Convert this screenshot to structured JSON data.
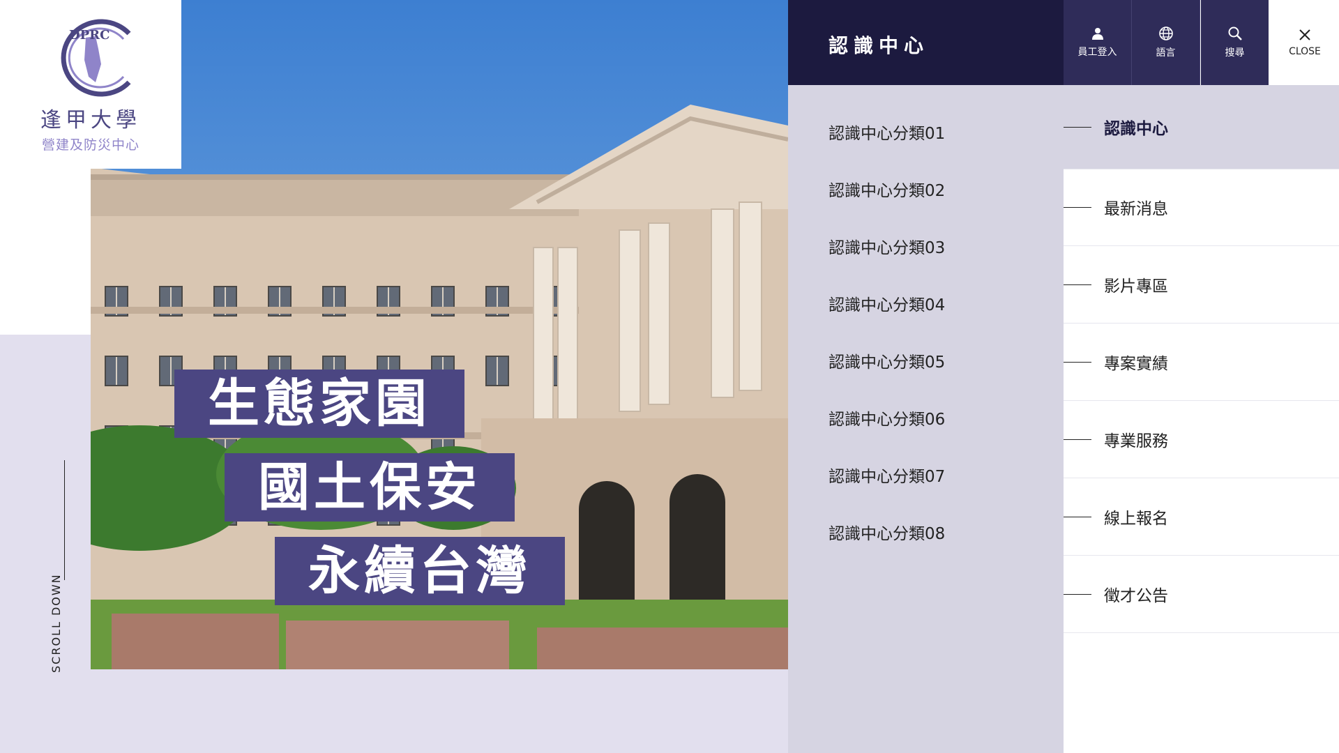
{
  "logo": {
    "mark_text": "DPRC",
    "university": "逢甲大學",
    "center": "營建及防災中心"
  },
  "hero": {
    "slogans": [
      "生態家園",
      "國土保安",
      "永續台灣"
    ]
  },
  "scroll": {
    "label": "SCROLL DOWN"
  },
  "menu": {
    "title": "認識中心",
    "tools": [
      {
        "label": "員工登入",
        "icon": "user-icon"
      },
      {
        "label": "語言",
        "icon": "globe-icon"
      },
      {
        "label": "搜尋",
        "icon": "search-icon"
      }
    ],
    "close": {
      "label": "CLOSE",
      "icon": "close-icon"
    },
    "categories": [
      "認識中心分類01",
      "認識中心分類02",
      "認識中心分類03",
      "認識中心分類04",
      "認識中心分類05",
      "認識中心分類06",
      "認識中心分類07",
      "認識中心分類08"
    ],
    "nav": [
      "認識中心",
      "最新消息",
      "影片專區",
      "專案實績",
      "專業服務",
      "線上報名",
      "徵才公告"
    ]
  },
  "colors": {
    "brand": "#4b4682",
    "header_dark": "#1c1a3f",
    "tool_bg": "#2f2c59",
    "menu_bg": "#d6d4e2",
    "lavender": "#e2dfee"
  }
}
